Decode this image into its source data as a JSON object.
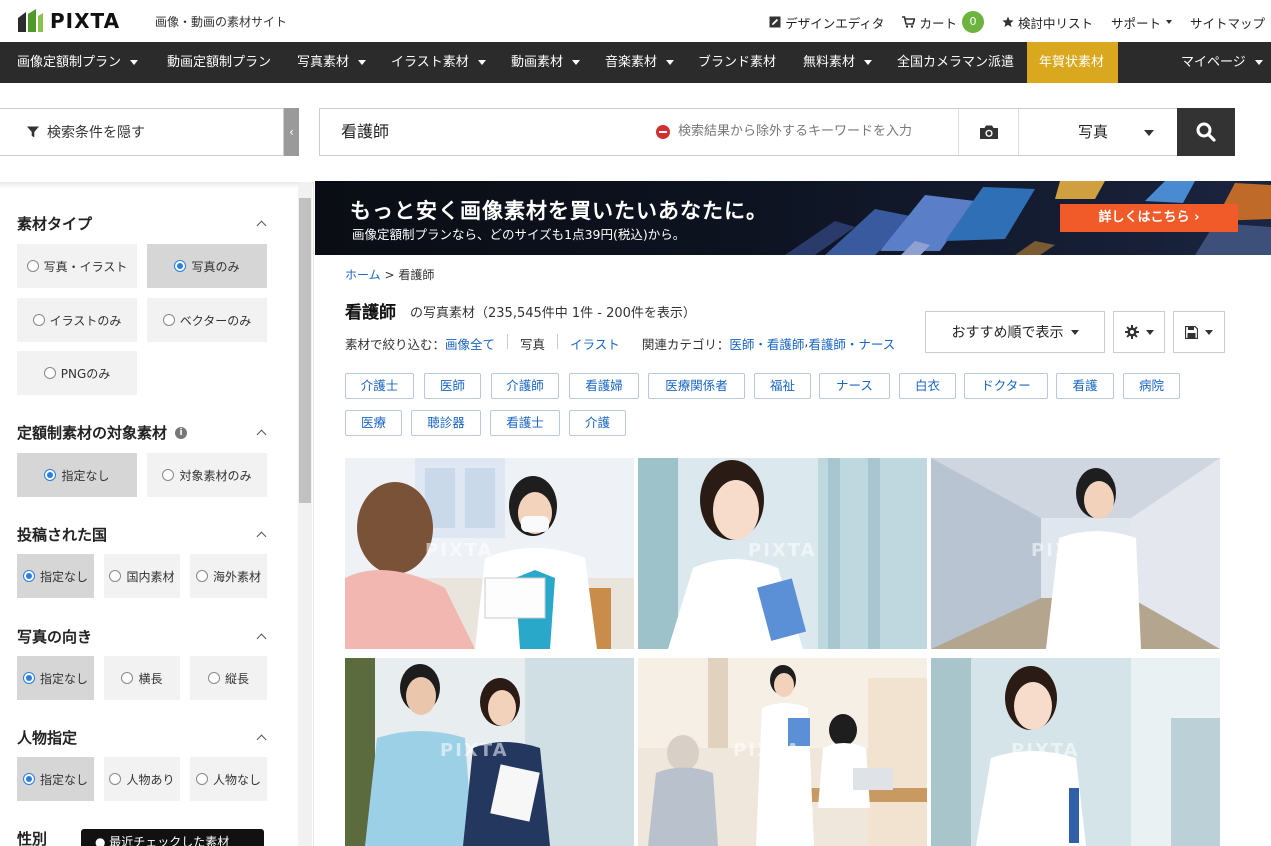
{
  "header": {
    "logo_text": "PIXTA",
    "tagline": "画像・動画の素材サイト",
    "links": {
      "design_editor": "デザインエディタ",
      "cart": "カート",
      "cart_count": "0",
      "wishlist": "検討中リスト",
      "support": "サポート",
      "sitemap": "サイトマップ"
    }
  },
  "nav": {
    "items": [
      "画像定額制プラン",
      "動画定額制プラン",
      "写真素材",
      "イラスト素材",
      "動画素材",
      "音楽素材",
      "ブランド素材",
      "無料素材",
      "全国カメラマン派遣",
      "年賀状素材"
    ],
    "mypage": "マイページ"
  },
  "search": {
    "filter_toggle": "検索条件を隠す",
    "collapse_glyph": "‹",
    "query": "看護師",
    "exclude_placeholder": "検索結果から除外するキーワードを入力",
    "type": "写真"
  },
  "sidebar": {
    "material_type": {
      "title": "素材タイプ",
      "options": [
        "写真・イラスト",
        "写真のみ",
        "イラストのみ",
        "ベクターのみ",
        "PNGのみ"
      ]
    },
    "subscription": {
      "title": "定額制素材の対象素材",
      "info": "i",
      "options": [
        "指定なし",
        "対象素材のみ"
      ]
    },
    "country": {
      "title": "投稿された国",
      "options": [
        "指定なし",
        "国内素材",
        "海外素材"
      ]
    },
    "orientation": {
      "title": "写真の向き",
      "options": [
        "指定なし",
        "横長",
        "縦長"
      ]
    },
    "people": {
      "title": "人物指定",
      "options": [
        "指定なし",
        "人物あり",
        "人物なし"
      ]
    },
    "gender": {
      "title": "性別"
    },
    "tooltip": "● 最近チェックした素材"
  },
  "banner": {
    "headline": "もっと安く画像素材を買いたいあなたに。",
    "sub": "画像定額制プランなら、どのサイズも1点39円(税込)から。",
    "cta": "詳しくはこちら ›"
  },
  "main": {
    "breadcrumb_home": "ホーム",
    "breadcrumb_sep": " > ",
    "breadcrumb_current": "看護師",
    "title": "看護師",
    "subtitle": "の写真素材（235,545件中 1件 - 200件を表示）",
    "filter_label": "素材で絞り込む：",
    "filter_all": "画像全て",
    "filter_photo": "写真",
    "filter_illust": "イラスト",
    "related_label": "関連カテゴリ：",
    "related_1": "医師・看護師",
    "related_sep": ", ",
    "related_2": "看護師・ナース",
    "sort": "おすすめ順で表示",
    "tags": [
      "介護士",
      "医師",
      "介護師",
      "看護婦",
      "医療関係者",
      "福祉",
      "ナース",
      "白衣",
      "ドクター",
      "看護",
      "病院",
      "医療",
      "聴診器",
      "看護士",
      "介護"
    ],
    "watermark": "PIXTA"
  },
  "colors": {
    "nav_bg": "#2b2b2b",
    "accent_gold": "#d9a81f",
    "link_blue": "#1a66c2",
    "cta_orange": "#f15a29",
    "badge_green": "#6cb33f"
  }
}
